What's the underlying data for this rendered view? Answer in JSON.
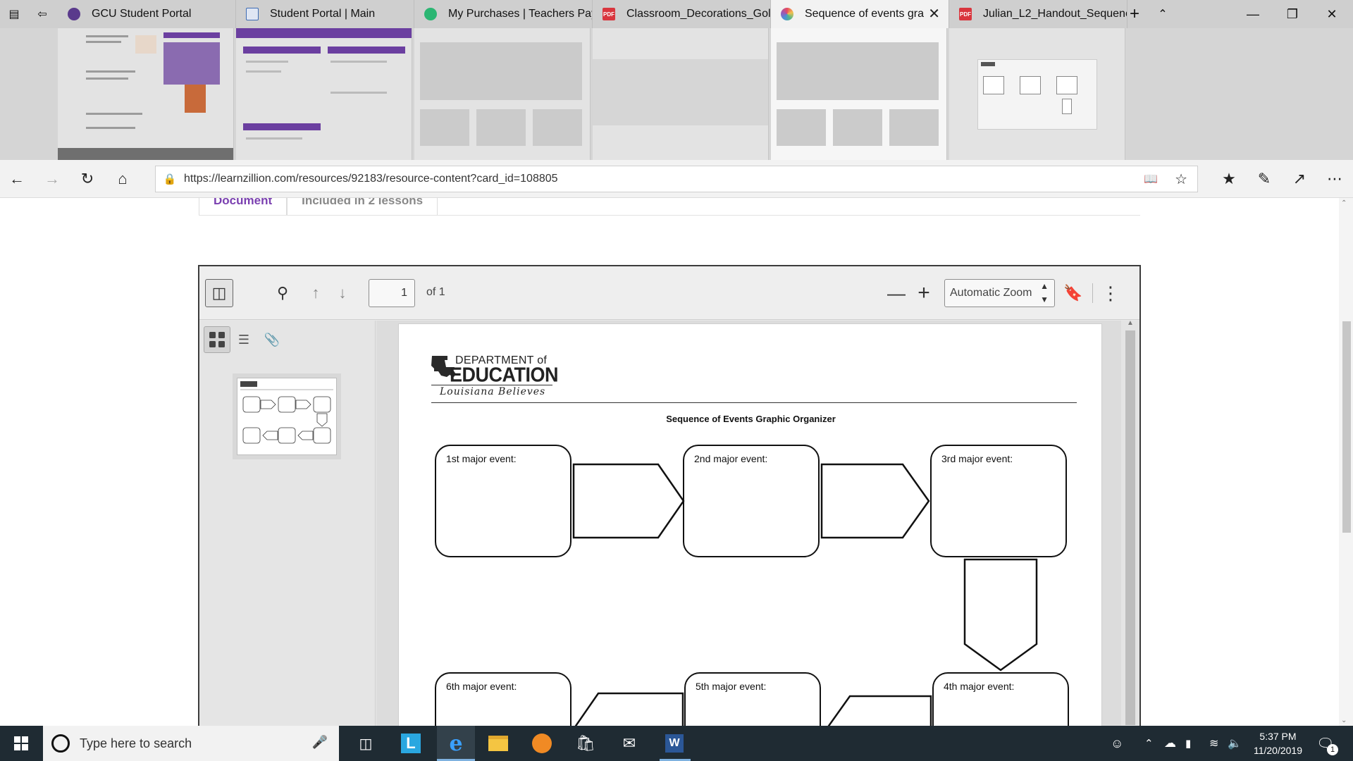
{
  "browser": {
    "tabs": [
      {
        "title": "GCU Student Portal",
        "favicon": "gcu-globe-icon",
        "color": "#5a3a8c"
      },
      {
        "title": "Student Portal | Main",
        "favicon": "document-icon",
        "color": "#3d6bb3"
      },
      {
        "title": "My Purchases | Teachers Pay",
        "favicon": "tpt-apple-icon",
        "color": "#2bb673"
      },
      {
        "title": "Classroom_Decorations_Gol",
        "favicon": "pdf-icon",
        "color": "#d9363e"
      },
      {
        "title": "Sequence of events gra",
        "favicon": "rainbow-circle-icon",
        "color": "#e98a4a",
        "active": true
      },
      {
        "title": "Julian_L2_Handout_Sequenc",
        "favicon": "pdf-icon",
        "color": "#d9363e"
      }
    ],
    "url": "https://learnzillion.com/resources/92183/resource-content?card_id=108805"
  },
  "page": {
    "tabs": [
      "Document",
      "Included in 2 lessons"
    ]
  },
  "viewer": {
    "page_number": "1",
    "page_count": "of 1",
    "zoom": "Automatic Zoom"
  },
  "document": {
    "logo_line1": "DEPARTMENT of",
    "logo_line2": "EDUCATION",
    "logo_tagline": "Louisiana Believes",
    "title": "Sequence of Events Graphic Organizer",
    "events": [
      {
        "label": "1st major event:"
      },
      {
        "label": "2nd major event:"
      },
      {
        "label": "3rd major event:"
      },
      {
        "label": "4th major event:"
      },
      {
        "label": "5th major event:"
      },
      {
        "label": "6th major event:"
      }
    ]
  },
  "taskbar": {
    "search_placeholder": "Type here to search",
    "time": "5:37 PM",
    "date": "11/20/2019",
    "notification_count": "1",
    "accent": "#7fb2e0"
  }
}
